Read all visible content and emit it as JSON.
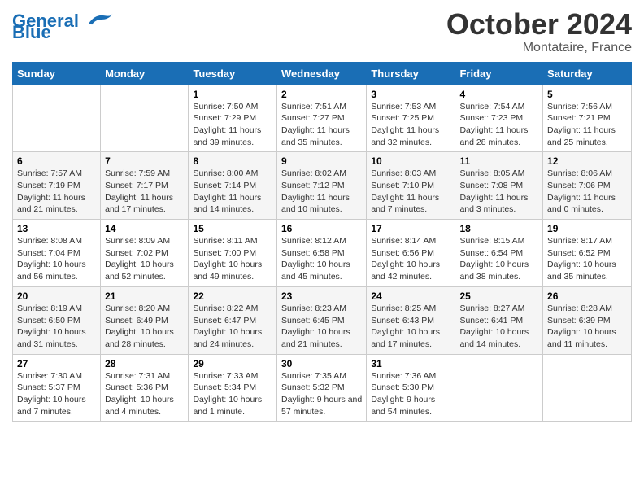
{
  "logo": {
    "line1": "General",
    "line2": "Blue"
  },
  "title": "October 2024",
  "subtitle": "Montataire, France",
  "days_header": [
    "Sunday",
    "Monday",
    "Tuesday",
    "Wednesday",
    "Thursday",
    "Friday",
    "Saturday"
  ],
  "weeks": [
    [
      {
        "day": "",
        "sunrise": "",
        "sunset": "",
        "daylight": ""
      },
      {
        "day": "",
        "sunrise": "",
        "sunset": "",
        "daylight": ""
      },
      {
        "day": "1",
        "sunrise": "Sunrise: 7:50 AM",
        "sunset": "Sunset: 7:29 PM",
        "daylight": "Daylight: 11 hours and 39 minutes."
      },
      {
        "day": "2",
        "sunrise": "Sunrise: 7:51 AM",
        "sunset": "Sunset: 7:27 PM",
        "daylight": "Daylight: 11 hours and 35 minutes."
      },
      {
        "day": "3",
        "sunrise": "Sunrise: 7:53 AM",
        "sunset": "Sunset: 7:25 PM",
        "daylight": "Daylight: 11 hours and 32 minutes."
      },
      {
        "day": "4",
        "sunrise": "Sunrise: 7:54 AM",
        "sunset": "Sunset: 7:23 PM",
        "daylight": "Daylight: 11 hours and 28 minutes."
      },
      {
        "day": "5",
        "sunrise": "Sunrise: 7:56 AM",
        "sunset": "Sunset: 7:21 PM",
        "daylight": "Daylight: 11 hours and 25 minutes."
      }
    ],
    [
      {
        "day": "6",
        "sunrise": "Sunrise: 7:57 AM",
        "sunset": "Sunset: 7:19 PM",
        "daylight": "Daylight: 11 hours and 21 minutes."
      },
      {
        "day": "7",
        "sunrise": "Sunrise: 7:59 AM",
        "sunset": "Sunset: 7:17 PM",
        "daylight": "Daylight: 11 hours and 17 minutes."
      },
      {
        "day": "8",
        "sunrise": "Sunrise: 8:00 AM",
        "sunset": "Sunset: 7:14 PM",
        "daylight": "Daylight: 11 hours and 14 minutes."
      },
      {
        "day": "9",
        "sunrise": "Sunrise: 8:02 AM",
        "sunset": "Sunset: 7:12 PM",
        "daylight": "Daylight: 11 hours and 10 minutes."
      },
      {
        "day": "10",
        "sunrise": "Sunrise: 8:03 AM",
        "sunset": "Sunset: 7:10 PM",
        "daylight": "Daylight: 11 hours and 7 minutes."
      },
      {
        "day": "11",
        "sunrise": "Sunrise: 8:05 AM",
        "sunset": "Sunset: 7:08 PM",
        "daylight": "Daylight: 11 hours and 3 minutes."
      },
      {
        "day": "12",
        "sunrise": "Sunrise: 8:06 AM",
        "sunset": "Sunset: 7:06 PM",
        "daylight": "Daylight: 11 hours and 0 minutes."
      }
    ],
    [
      {
        "day": "13",
        "sunrise": "Sunrise: 8:08 AM",
        "sunset": "Sunset: 7:04 PM",
        "daylight": "Daylight: 10 hours and 56 minutes."
      },
      {
        "day": "14",
        "sunrise": "Sunrise: 8:09 AM",
        "sunset": "Sunset: 7:02 PM",
        "daylight": "Daylight: 10 hours and 52 minutes."
      },
      {
        "day": "15",
        "sunrise": "Sunrise: 8:11 AM",
        "sunset": "Sunset: 7:00 PM",
        "daylight": "Daylight: 10 hours and 49 minutes."
      },
      {
        "day": "16",
        "sunrise": "Sunrise: 8:12 AM",
        "sunset": "Sunset: 6:58 PM",
        "daylight": "Daylight: 10 hours and 45 minutes."
      },
      {
        "day": "17",
        "sunrise": "Sunrise: 8:14 AM",
        "sunset": "Sunset: 6:56 PM",
        "daylight": "Daylight: 10 hours and 42 minutes."
      },
      {
        "day": "18",
        "sunrise": "Sunrise: 8:15 AM",
        "sunset": "Sunset: 6:54 PM",
        "daylight": "Daylight: 10 hours and 38 minutes."
      },
      {
        "day": "19",
        "sunrise": "Sunrise: 8:17 AM",
        "sunset": "Sunset: 6:52 PM",
        "daylight": "Daylight: 10 hours and 35 minutes."
      }
    ],
    [
      {
        "day": "20",
        "sunrise": "Sunrise: 8:19 AM",
        "sunset": "Sunset: 6:50 PM",
        "daylight": "Daylight: 10 hours and 31 minutes."
      },
      {
        "day": "21",
        "sunrise": "Sunrise: 8:20 AM",
        "sunset": "Sunset: 6:49 PM",
        "daylight": "Daylight: 10 hours and 28 minutes."
      },
      {
        "day": "22",
        "sunrise": "Sunrise: 8:22 AM",
        "sunset": "Sunset: 6:47 PM",
        "daylight": "Daylight: 10 hours and 24 minutes."
      },
      {
        "day": "23",
        "sunrise": "Sunrise: 8:23 AM",
        "sunset": "Sunset: 6:45 PM",
        "daylight": "Daylight: 10 hours and 21 minutes."
      },
      {
        "day": "24",
        "sunrise": "Sunrise: 8:25 AM",
        "sunset": "Sunset: 6:43 PM",
        "daylight": "Daylight: 10 hours and 17 minutes."
      },
      {
        "day": "25",
        "sunrise": "Sunrise: 8:27 AM",
        "sunset": "Sunset: 6:41 PM",
        "daylight": "Daylight: 10 hours and 14 minutes."
      },
      {
        "day": "26",
        "sunrise": "Sunrise: 8:28 AM",
        "sunset": "Sunset: 6:39 PM",
        "daylight": "Daylight: 10 hours and 11 minutes."
      }
    ],
    [
      {
        "day": "27",
        "sunrise": "Sunrise: 7:30 AM",
        "sunset": "Sunset: 5:37 PM",
        "daylight": "Daylight: 10 hours and 7 minutes."
      },
      {
        "day": "28",
        "sunrise": "Sunrise: 7:31 AM",
        "sunset": "Sunset: 5:36 PM",
        "daylight": "Daylight: 10 hours and 4 minutes."
      },
      {
        "day": "29",
        "sunrise": "Sunrise: 7:33 AM",
        "sunset": "Sunset: 5:34 PM",
        "daylight": "Daylight: 10 hours and 1 minute."
      },
      {
        "day": "30",
        "sunrise": "Sunrise: 7:35 AM",
        "sunset": "Sunset: 5:32 PM",
        "daylight": "Daylight: 9 hours and 57 minutes."
      },
      {
        "day": "31",
        "sunrise": "Sunrise: 7:36 AM",
        "sunset": "Sunset: 5:30 PM",
        "daylight": "Daylight: 9 hours and 54 minutes."
      },
      {
        "day": "",
        "sunrise": "",
        "sunset": "",
        "daylight": ""
      },
      {
        "day": "",
        "sunrise": "",
        "sunset": "",
        "daylight": ""
      }
    ]
  ]
}
